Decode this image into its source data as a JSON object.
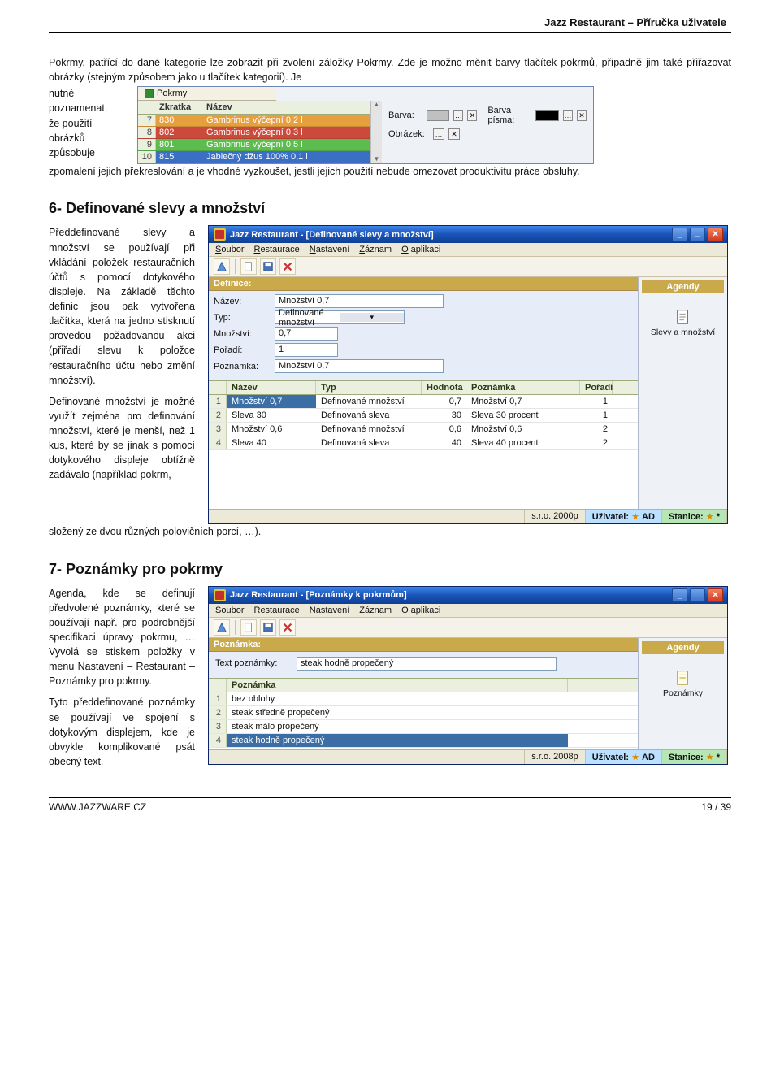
{
  "doc": {
    "header": "Jazz Restaurant – Příručka uživatele",
    "footer_left": "WWW.JAZZWARE.CZ",
    "footer_right": "19 / 39"
  },
  "para1a": "Pokrmy, patřící do dané kategorie lze zobrazit při zvolení záložky Pokrmy. Zde je možno měnit barvy tlačítek pokrmů, případně jim také přiřazovat obrázky (stejným způsobem jako u tlačítek kategorií). Je",
  "para1_words": [
    "nutné",
    "poznamenat,",
    "že použití",
    "obrázků",
    "způsobuje"
  ],
  "para1c": "zpomalení jejich překreslování a je vhodné vyzkoušet, jestli jejich použití nebude omezovat produktivitu práce obsluhy.",
  "shot1": {
    "tab": "Pokrmy",
    "col_zkratka": "Zkratka",
    "col_nazev": "Název",
    "rows": [
      {
        "n": "7",
        "zk": "830",
        "nz": "Gambrinus výčepní 0,2 l",
        "bg": "#e79e3d"
      },
      {
        "n": "8",
        "zk": "802",
        "nz": "Gambrinus výčepní 0,3 l",
        "bg": "#cc4a3a"
      },
      {
        "n": "9",
        "zk": "801",
        "nz": "Gambrinus výčepní 0,5 l",
        "bg": "#5cbc4e"
      },
      {
        "n": "10",
        "zk": "815",
        "nz": "Jablečný džus 100% 0,1 l",
        "bg": "#3a6fc4"
      }
    ],
    "right": {
      "barva_label": "Barva:",
      "barva_pisma_label": "Barva písma:",
      "obrazek_label": "Obrázek:",
      "barva_sw": "#c0c0c0",
      "pisma_sw": "#000000"
    }
  },
  "h6": "6- Definované slevy a množství",
  "p6a": "Předdefinované slevy a množství se používají při vkládání položek restauračních účtů s pomocí dotykového displeje. Na základě těchto definic jsou pak vytvořena tlačítka, která na jedno stisknutí provedou požadovanou akci (přiřadí slevu k položce restauračního účtu nebo změní množství).",
  "p6b_narrow": "Definované množství je možné využít zejména pro definování množství, které je menší, než 1 kus, které by se jinak s pomocí dotykového displeje obtížně zadávalo (například pokrm,",
  "p6b_tail": "složený ze dvou různých polovičních porcí, …).",
  "app1": {
    "title": "Jazz Restaurant - [Definované slevy a množství]",
    "menu": {
      "m1": "Soubor",
      "m2": "Restaurace",
      "m3": "Nastavení",
      "m4": "Záznam",
      "m5": "O aplikaci"
    },
    "section": "Definice:",
    "labels": {
      "nazev": "Název:",
      "typ": "Typ:",
      "mnozstvi": "Množství:",
      "poradi": "Pořadí:",
      "poznamka": "Poznámka:"
    },
    "values": {
      "nazev": "Množství 0,7",
      "typ": "Definované množství",
      "mnozstvi": "0,7",
      "poradi": "1",
      "poznamka": "Množství 0,7"
    },
    "side": {
      "agendy": "Agendy",
      "slevy": "Slevy a množství"
    },
    "cols": {
      "nazev": "Název",
      "typ": "Typ",
      "hodnota": "Hodnota",
      "poznamka": "Poznámka",
      "poradi": "Pořadí"
    },
    "rows": [
      {
        "n": "1",
        "nazev": "Množství 0,7",
        "typ": "Definované množství",
        "hod": "0,7",
        "poz": "Množství 0,7",
        "por": "1",
        "sel": true
      },
      {
        "n": "2",
        "nazev": "Sleva 30",
        "typ": "Definovaná sleva",
        "hod": "30",
        "poz": "Sleva 30 procent",
        "por": "1"
      },
      {
        "n": "3",
        "nazev": "Množství 0,6",
        "typ": "Definované množství",
        "hod": "0,6",
        "poz": "Množství 0,6",
        "por": "2"
      },
      {
        "n": "4",
        "nazev": "Sleva 40",
        "typ": "Definovaná sleva",
        "hod": "40",
        "poz": "Sleva 40 procent",
        "por": "2"
      }
    ],
    "status": {
      "company": "s.r.o. 2000p",
      "uzivatel_l": "Uživatel:",
      "uzivatel_v": "AD",
      "stanice_l": "Stanice:",
      "stanice_v": "*"
    }
  },
  "h7": "7- Poznámky pro pokrmy",
  "p7a": "Agenda, kde se definují předvolené poznámky, které se používají např. pro podrobnější specifikaci úpravy pokrmu, … Vyvolá se stiskem položky v menu Nastavení – Restaurant – Poznámky pro pokrmy.",
  "p7b": "Tyto předdefinované poznámky se používají ve spojení s dotykovým displejem, kde je obvykle komplikované psát obecný text.",
  "app2": {
    "title": "Jazz Restaurant - [Poznámky k pokrmům]",
    "menu": {
      "m1": "Soubor",
      "m2": "Restaurace",
      "m3": "Nastavení",
      "m4": "Záznam",
      "m5": "O aplikaci"
    },
    "section": "Poznámka:",
    "label_text": "Text poznámky:",
    "value_text": "steak hodně propečený",
    "side": {
      "agendy": "Agendy",
      "poznamky": "Poznámky"
    },
    "col_poznamka": "Poznámka",
    "rows": [
      {
        "n": "1",
        "poz": "bez oblohy"
      },
      {
        "n": "2",
        "poz": "steak středně propečený"
      },
      {
        "n": "3",
        "poz": "steak málo propečený"
      },
      {
        "n": "4",
        "poz": "steak hodně propečený",
        "sel": true
      }
    ],
    "status": {
      "company": "s.r.o. 2008p",
      "uzivatel_l": "Uživatel:",
      "uzivatel_v": "AD",
      "stanice_l": "Stanice:",
      "stanice_v": "*"
    }
  }
}
